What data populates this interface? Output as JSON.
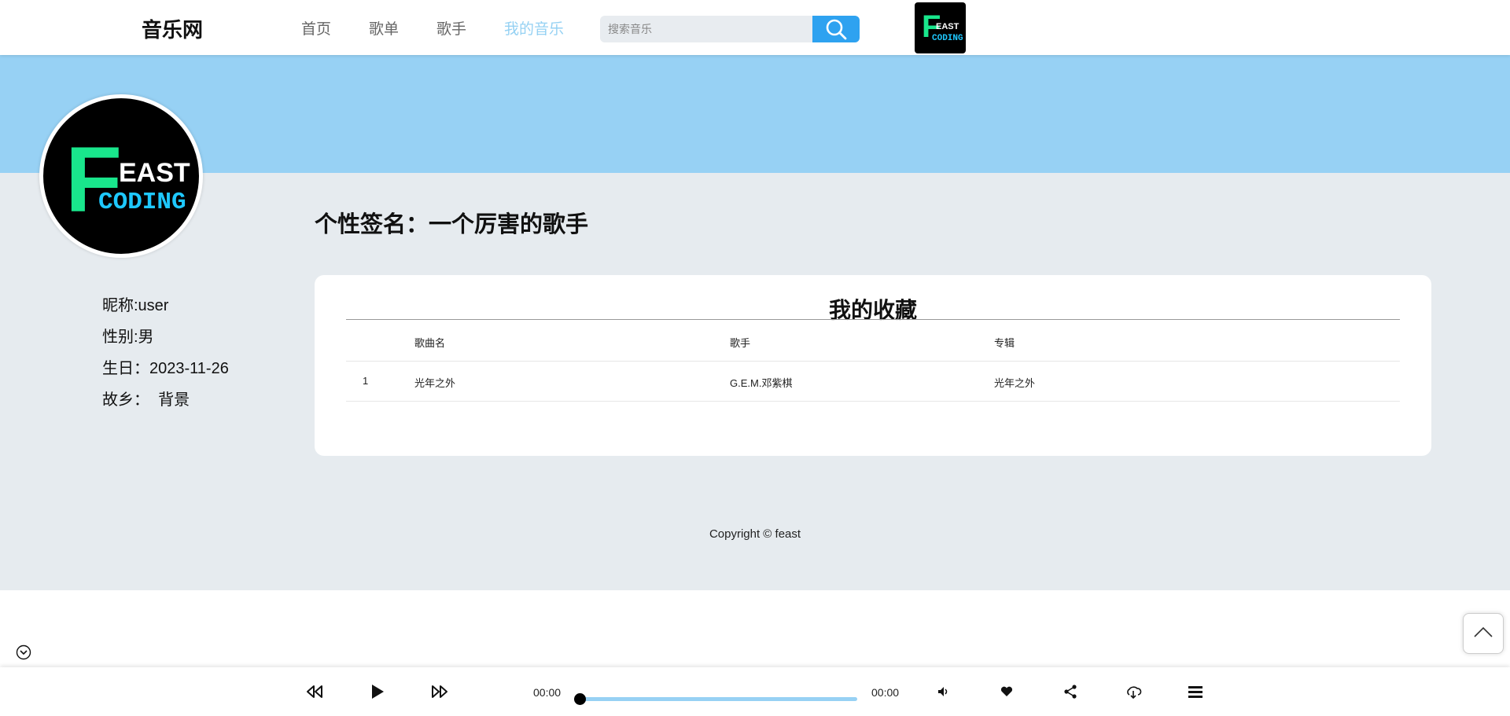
{
  "header": {
    "site_title": "音乐网",
    "nav": [
      "首页",
      "歌单",
      "歌手",
      "我的音乐"
    ],
    "active_nav": "我的音乐",
    "search_placeholder": "搜索音乐",
    "logo": {
      "big_letter": "F",
      "line1": "EAST",
      "line2": "CODING"
    }
  },
  "avatar": {
    "big_letter": "F",
    "line1": "EAST",
    "line2": "CODING"
  },
  "profile": {
    "nickname": "昵称:user",
    "gender": "性别:男",
    "birthday": "生日：2023-11-26",
    "hometown": "故乡：  背景"
  },
  "signature": "个性签名：一个厉害的歌手",
  "favorites": {
    "title": "我的收藏",
    "columns": [
      "歌曲名",
      "歌手",
      "专辑"
    ],
    "rows": [
      {
        "index": "1",
        "song": "光年之外",
        "artist": "G.E.M.邓紫棋",
        "album": "光年之外"
      }
    ]
  },
  "footer": "Copyright © feast",
  "player": {
    "current_time": "00:00",
    "total_time": "00:00",
    "progress": 0
  },
  "colors": {
    "accent": "#2ea2f0",
    "banner": "#97d1f4",
    "active_nav": "#95d1f3",
    "content_bg": "#e6ebef",
    "logo_green": "#19e68c",
    "logo_cyan": "#1ec8ff"
  },
  "icons": [
    "search-icon",
    "collapse-chevron-icon",
    "back-to-top-icon",
    "rewind-icon",
    "play-icon",
    "fast-forward-icon",
    "volume-icon",
    "heart-icon",
    "share-icon",
    "download-icon",
    "playlist-icon"
  ]
}
